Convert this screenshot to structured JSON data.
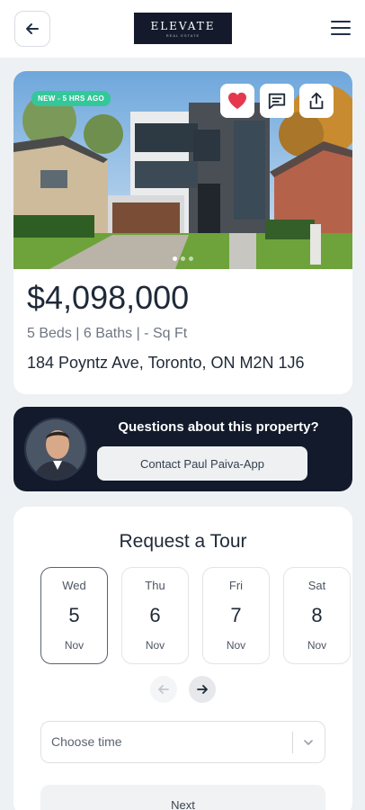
{
  "header": {
    "back_icon": "arrow-left-icon",
    "logo": {
      "name": "ELEVATE",
      "tagline": "REAL ESTATE"
    },
    "menu_icon": "hamburger-menu-icon"
  },
  "listing": {
    "badge": "NEW - 5 HRS AGO",
    "actions": {
      "favorite_icon": "heart-icon",
      "message_icon": "message-icon",
      "share_icon": "share-icon"
    },
    "favorite_color": "#e5384f",
    "photo_count": 3,
    "active_photo": 1,
    "price": "$4,098,000",
    "specs": "5 Beds | 6 Baths | - Sq Ft",
    "address": "184 Poyntz Ave, Toronto, ON M2N 1J6"
  },
  "contact": {
    "question": "Questions about this property?",
    "button_label": "Contact Paul Paiva-App"
  },
  "tour": {
    "title": "Request a Tour",
    "days": [
      {
        "weekday": "Wed",
        "day": "5",
        "month": "Nov",
        "selected": true
      },
      {
        "weekday": "Thu",
        "day": "6",
        "month": "Nov",
        "selected": false
      },
      {
        "weekday": "Fri",
        "day": "7",
        "month": "Nov",
        "selected": false
      },
      {
        "weekday": "Sat",
        "day": "8",
        "month": "Nov",
        "selected": false
      }
    ],
    "prev_icon": "arrow-left-icon",
    "next_icon": "arrow-right-icon",
    "time_placeholder": "Choose time",
    "next_label": "Next"
  },
  "colors": {
    "dark": "#121a2c",
    "badge": "#34c79a",
    "background": "#eef1f3"
  }
}
